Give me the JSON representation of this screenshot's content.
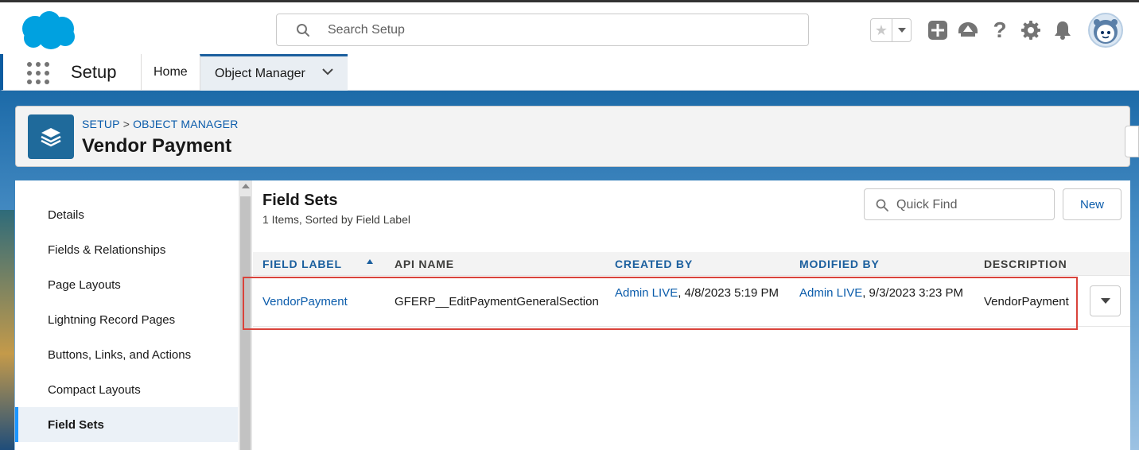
{
  "header": {
    "search_placeholder": "Search Setup"
  },
  "nav": {
    "app_name": "Setup",
    "tabs": [
      {
        "label": "Home"
      },
      {
        "label": "Object Manager"
      }
    ]
  },
  "page_header": {
    "breadcrumb_setup": "SETUP",
    "breadcrumb_sep": ">",
    "breadcrumb_object_manager": "OBJECT MANAGER",
    "title": "Vendor Payment"
  },
  "sidebar": {
    "items": [
      {
        "label": "Details"
      },
      {
        "label": "Fields & Relationships"
      },
      {
        "label": "Page Layouts"
      },
      {
        "label": "Lightning Record Pages"
      },
      {
        "label": "Buttons, Links, and Actions"
      },
      {
        "label": "Compact Layouts"
      },
      {
        "label": "Field Sets"
      }
    ],
    "active": "Field Sets"
  },
  "content": {
    "title": "Field Sets",
    "subtitle": "1 Items, Sorted by Field Label",
    "quick_find_placeholder": "Quick Find",
    "new_label": "New",
    "columns": [
      "FIELD LABEL",
      "API NAME",
      "CREATED BY",
      "MODIFIED BY",
      "DESCRIPTION"
    ],
    "rows": [
      {
        "field_label": "VendorPayment",
        "api_name": "GFERP__EditPaymentGeneralSection",
        "created_by_user": "Admin LIVE",
        "created_by_date": ", 4/8/2023 5:19 PM",
        "modified_by_user": "Admin LIVE",
        "modified_by_date": ", 9/3/2023 3:23 PM",
        "description": "VendorPayment"
      }
    ]
  },
  "colors": {
    "brand_blue": "#1b5f9e",
    "link_blue": "#0b5cab",
    "highlight_red": "#d9433b",
    "salesforce_cloud": "#00a1e0"
  }
}
